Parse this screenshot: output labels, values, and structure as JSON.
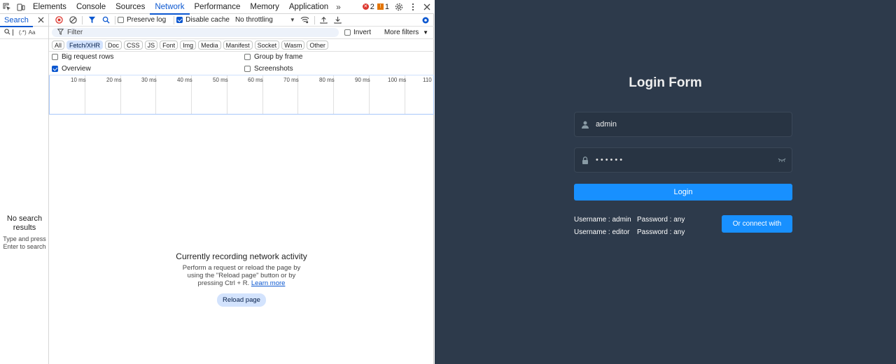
{
  "devtools": {
    "tabs": [
      {
        "label": "Elements"
      },
      {
        "label": "Console"
      },
      {
        "label": "Sources"
      },
      {
        "label": "Network"
      },
      {
        "label": "Performance"
      },
      {
        "label": "Memory"
      },
      {
        "label": "Application"
      }
    ],
    "more_tabs": "»",
    "errors_count": "2",
    "warnings_count": "1",
    "search": {
      "tab_label": "Search",
      "case_option": "Aa",
      "regex_option": "(.*)",
      "no_results_title": "No search results",
      "no_results_hint": "Type and press Enter to search"
    },
    "network": {
      "preserve_log": "Preserve log",
      "disable_cache": "Disable cache",
      "throttling": "No throttling",
      "filter_placeholder": "Filter",
      "invert": "Invert",
      "more_filters": "More filters",
      "type_filters": [
        "All",
        "Fetch/XHR",
        "Doc",
        "CSS",
        "JS",
        "Font",
        "Img",
        "Media",
        "Manifest",
        "Socket",
        "Wasm",
        "Other"
      ],
      "active_type_filter": "Fetch/XHR",
      "options": {
        "big_request_rows": "Big request rows",
        "group_by_frame": "Group by frame",
        "overview": "Overview",
        "screenshots": "Screenshots"
      },
      "timeline_ticks": [
        "10 ms",
        "20 ms",
        "30 ms",
        "40 ms",
        "50 ms",
        "60 ms",
        "70 ms",
        "80 ms",
        "90 ms",
        "100 ms",
        "110"
      ],
      "empty_title": "Currently recording network activity",
      "empty_text_1": "Perform a request or reload the page by",
      "empty_text_2": "using the \"Reload page\" button or by",
      "empty_text_3": "pressing Ctrl + R.",
      "learn_more": "Learn more",
      "reload_button": "Reload page"
    }
  },
  "app": {
    "title": "Login Form",
    "username_value": "admin",
    "password_value": "••••••",
    "login_button": "Login",
    "tips": [
      {
        "username": "Username : admin",
        "password": "Password : any"
      },
      {
        "username": "Username : editor",
        "password": "Password : any"
      }
    ],
    "connect_button": "Or connect with",
    "colors": {
      "background": "#2d3a4b",
      "primary": "#1890ff",
      "devtools_accent": "#0b57d0"
    }
  }
}
